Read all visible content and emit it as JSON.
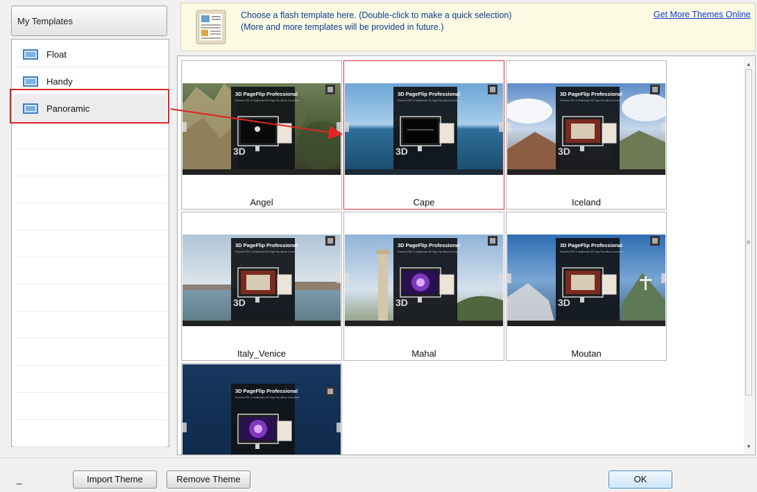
{
  "sidebar": {
    "header": "My Templates",
    "items": [
      {
        "label": "Float",
        "icon": "template-icon",
        "selected": false
      },
      {
        "label": "Handy",
        "icon": "template-icon",
        "selected": false
      },
      {
        "label": "Panoramic",
        "icon": "template-icon",
        "selected": true
      }
    ]
  },
  "banner": {
    "line1": "Choose a flash template here. (Double-click to make a quick selection)",
    "line2": "(More and more templates will be provided in future.)",
    "link": "Get More Themes Online",
    "icon": "book-icon"
  },
  "preview": {
    "title": "3D PageFlip Professional",
    "subtitle": "Powerful PDF & Multimedia 3D Page Flip eBook Converter!",
    "badge": "3D"
  },
  "templates": [
    {
      "name": "Angel",
      "selected": false,
      "theme": "angel"
    },
    {
      "name": "Cape",
      "selected": true,
      "theme": "cape"
    },
    {
      "name": "Iceland",
      "selected": false,
      "theme": "iceland"
    },
    {
      "name": "Italy_Venice",
      "selected": false,
      "theme": "venice"
    },
    {
      "name": "Mahal",
      "selected": false,
      "theme": "mahal"
    },
    {
      "name": "Moutan",
      "selected": false,
      "theme": "moutan"
    },
    {
      "name": "",
      "selected": false,
      "theme": "space"
    }
  ],
  "buttons": {
    "minimize": "_",
    "import": "Import Theme",
    "remove": "Remove Theme",
    "ok": "OK"
  },
  "colors": {
    "highlight": "#e02424",
    "banner_text": "#0a3d91",
    "link": "#0a3ad6"
  }
}
